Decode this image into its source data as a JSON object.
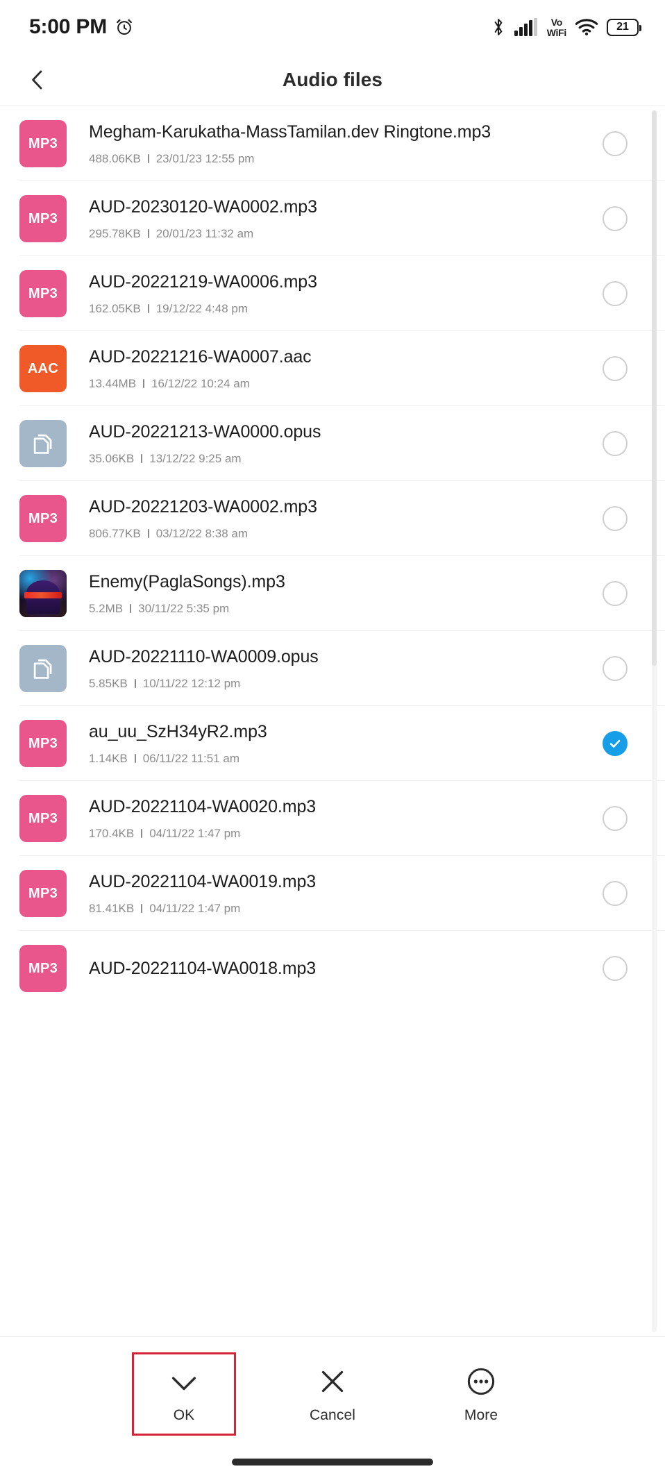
{
  "status_bar": {
    "time": "5:00 PM",
    "alarm_icon": "alarm-clock-icon",
    "bluetooth_icon": "bluetooth-icon",
    "signal_icon": "cellular-signal-icon",
    "vowifi_line1": "Vo",
    "vowifi_line2": "WiFi",
    "wifi_icon": "wifi-icon",
    "battery_level": "21"
  },
  "header": {
    "title": "Audio files",
    "back_icon": "chevron-left-icon"
  },
  "colors": {
    "mp3_badge": "#e8568b",
    "aac_badge": "#f05a28",
    "doc_badge": "#a4b7c8",
    "selected_radio": "#169fe8",
    "highlight_box": "#d42435"
  },
  "list": {
    "files": [
      {
        "name": "Megham-Karukatha-MassTamilan.dev Ringtone.mp3",
        "size": "488.06KB",
        "date": "23/01/23 12:55 pm",
        "badge": "MP3",
        "type": "mp3",
        "selected": false
      },
      {
        "name": "AUD-20230120-WA0002.mp3",
        "size": "295.78KB",
        "date": "20/01/23 11:32 am",
        "badge": "MP3",
        "type": "mp3",
        "selected": false
      },
      {
        "name": "AUD-20221219-WA0006.mp3",
        "size": "162.05KB",
        "date": "19/12/22 4:48 pm",
        "badge": "MP3",
        "type": "mp3",
        "selected": false
      },
      {
        "name": "AUD-20221216-WA0007.aac",
        "size": "13.44MB",
        "date": "16/12/22 10:24 am",
        "badge": "AAC",
        "type": "aac",
        "selected": false
      },
      {
        "name": "AUD-20221213-WA0000.opus",
        "size": "35.06KB",
        "date": "13/12/22 9:25 am",
        "badge": "",
        "type": "doc",
        "selected": false
      },
      {
        "name": "AUD-20221203-WA0002.mp3",
        "size": "806.77KB",
        "date": "03/12/22 8:38 am",
        "badge": "MP3",
        "type": "mp3",
        "selected": false
      },
      {
        "name": "Enemy(PaglaSongs).mp3",
        "size": "5.2MB",
        "date": "30/11/22 5:35 pm",
        "badge": "",
        "type": "art",
        "selected": false
      },
      {
        "name": "AUD-20221110-WA0009.opus",
        "size": "5.85KB",
        "date": "10/11/22 12:12 pm",
        "badge": "",
        "type": "doc",
        "selected": false
      },
      {
        "name": "au_uu_SzH34yR2.mp3",
        "size": "1.14KB",
        "date": "06/11/22 11:51 am",
        "badge": "MP3",
        "type": "mp3",
        "selected": true
      },
      {
        "name": "AUD-20221104-WA0020.mp3",
        "size": "170.4KB",
        "date": "04/11/22 1:47 pm",
        "badge": "MP3",
        "type": "mp3",
        "selected": false
      },
      {
        "name": "AUD-20221104-WA0019.mp3",
        "size": "81.41KB",
        "date": "04/11/22 1:47 pm",
        "badge": "MP3",
        "type": "mp3",
        "selected": false
      },
      {
        "name": "AUD-20221104-WA0018.mp3",
        "size": "",
        "date": "",
        "badge": "MP3",
        "type": "mp3",
        "selected": false
      }
    ]
  },
  "bottom_bar": {
    "actions": [
      {
        "label": "OK",
        "icon": "check-icon",
        "highlighted": true
      },
      {
        "label": "Cancel",
        "icon": "close-x-icon",
        "highlighted": false
      },
      {
        "label": "More",
        "icon": "more-ellipsis-icon",
        "highlighted": false
      }
    ]
  }
}
